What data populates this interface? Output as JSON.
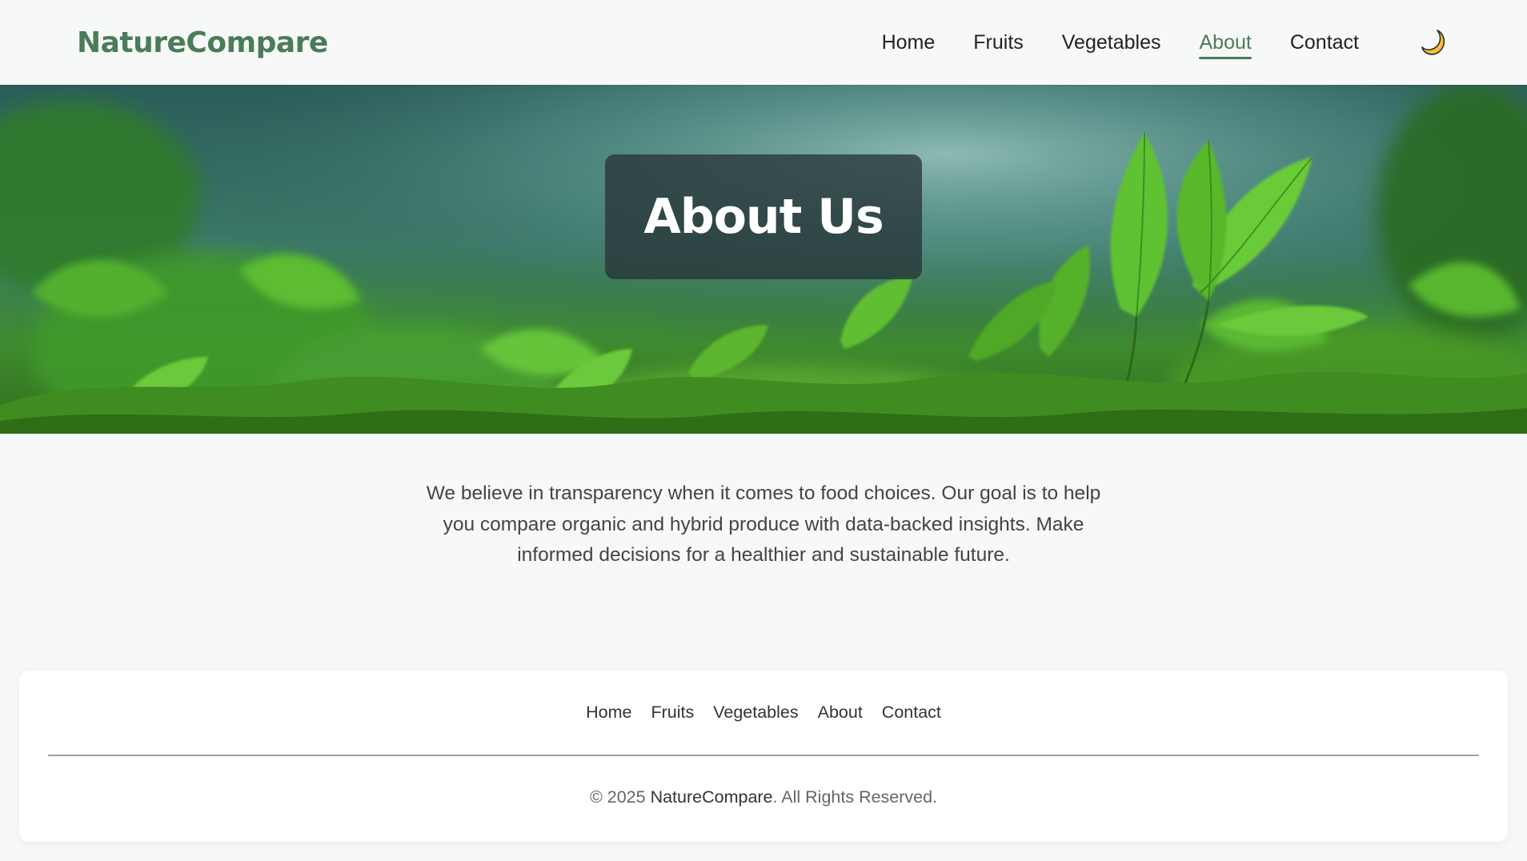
{
  "header": {
    "logo": "NatureCompare",
    "nav": [
      {
        "label": "Home"
      },
      {
        "label": "Fruits"
      },
      {
        "label": "Vegetables"
      },
      {
        "label": "About",
        "active": true
      },
      {
        "label": "Contact"
      }
    ],
    "theme_toggle_icon": "moon-icon"
  },
  "hero": {
    "title": "About Us",
    "background": "green-leaves-image"
  },
  "intro": {
    "text": "We believe in transparency when it comes to food choices. Our goal is to help you compare organic and hybrid produce with data-backed insights. Make informed decisions for a healthier and sustainable future."
  },
  "footer": {
    "nav": [
      {
        "label": "Home"
      },
      {
        "label": "Fruits"
      },
      {
        "label": "Vegetables"
      },
      {
        "label": "About"
      },
      {
        "label": "Contact"
      }
    ],
    "copyright_prefix": "© 2025 ",
    "copyright_brand": "NatureCompare",
    "copyright_suffix": ". All Rights Reserved."
  },
  "colors": {
    "accent": "#4a7c59",
    "page_background": "#f7f8fa",
    "hero_badge": "#283438"
  }
}
